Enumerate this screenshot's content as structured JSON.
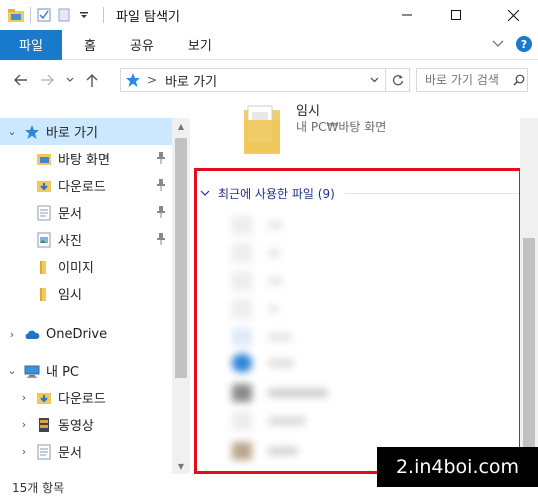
{
  "window": {
    "title": "파일 탐색기",
    "buttons": {
      "minimize": "—",
      "maximize": "☐",
      "close": "✕"
    }
  },
  "ribbon": {
    "tabs": [
      "파일",
      "홈",
      "공유",
      "보기"
    ],
    "help": "?"
  },
  "address": {
    "path_label": "바로 가기",
    "separator": ">",
    "search_placeholder": "바로 가기 검색"
  },
  "sidebar": {
    "items": [
      {
        "label": "바로 가기",
        "icon": "star-icon",
        "chevron": "⌄",
        "selected": true
      },
      {
        "label": "바탕 화면",
        "icon": "desktop-folder-icon",
        "pinned": true
      },
      {
        "label": "다운로드",
        "icon": "download-folder-icon",
        "pinned": true
      },
      {
        "label": "문서",
        "icon": "document-folder-icon",
        "pinned": true
      },
      {
        "label": "사진",
        "icon": "picture-folder-icon",
        "pinned": true
      },
      {
        "label": "이미지",
        "icon": "folder-icon"
      },
      {
        "label": "임시",
        "icon": "folder-icon"
      },
      {
        "label": "OneDrive",
        "icon": "cloud-icon",
        "chevron": "›"
      },
      {
        "label": "내 PC",
        "icon": "computer-icon",
        "chevron": "⌄"
      },
      {
        "label": "다운로드",
        "icon": "download-folder-icon",
        "chevron": "›"
      },
      {
        "label": "동영상",
        "icon": "video-folder-icon",
        "chevron": "›"
      },
      {
        "label": "문서",
        "icon": "document-folder-icon",
        "chevron": "›"
      }
    ]
  },
  "content": {
    "folder": {
      "name": "임시",
      "path": "내 PC₩바탕 화면"
    },
    "recent_header": "최근에 사용한 파일 (9)"
  },
  "status": {
    "item_count": "15개 항목"
  },
  "watermark": "2.in4boi.com",
  "colors": {
    "accent": "#1979ca",
    "selected": "#cce8ff",
    "highlight": "#e30b1c",
    "header_text": "#1e3287"
  }
}
